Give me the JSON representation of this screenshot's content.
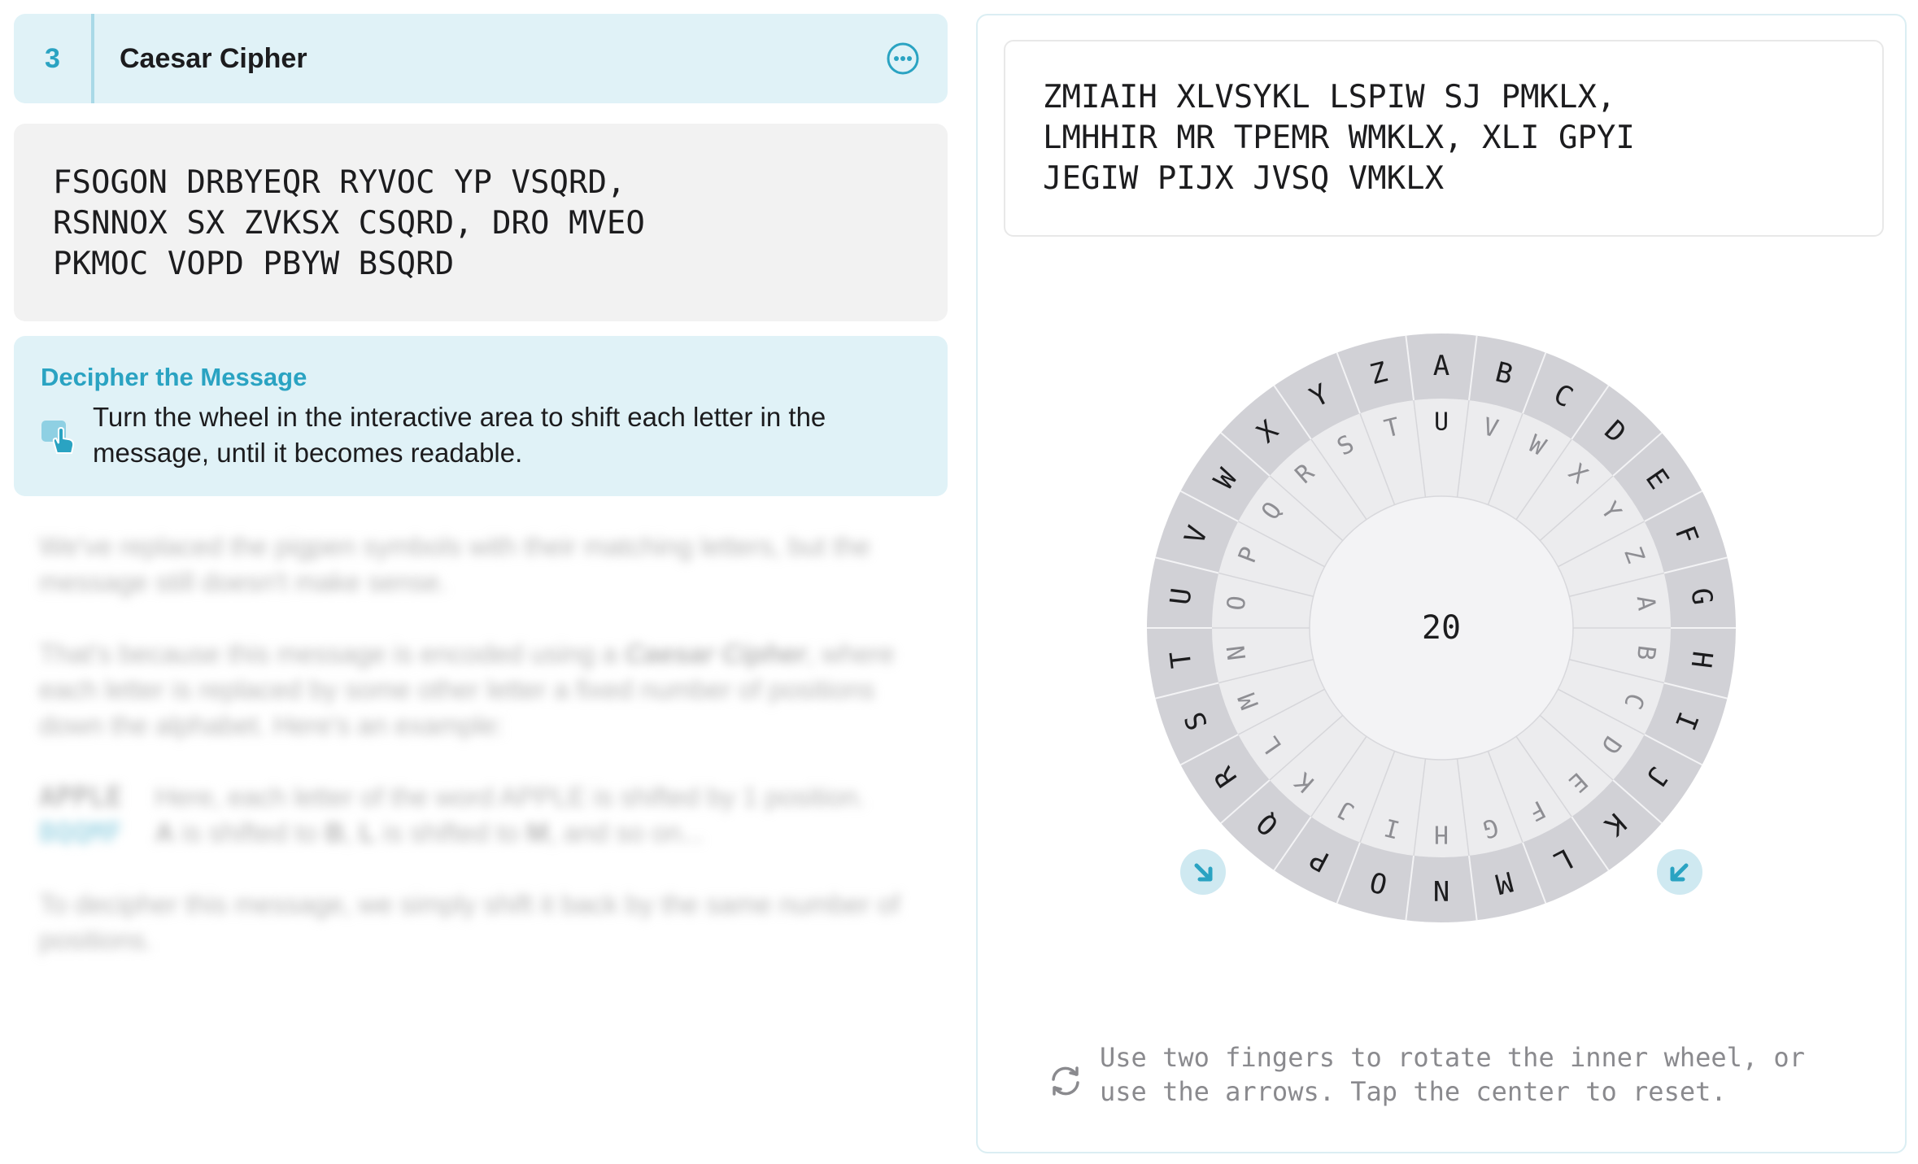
{
  "header": {
    "step_number": "3",
    "title": "Caesar Cipher",
    "more_icon": "ellipsis-circle-icon"
  },
  "cipher": {
    "lines": [
      "FSOGON DRBYEQR RYVOC YP VSQRD,",
      "RSNNOX SX ZVKSX CSQRD, DRO MVEO",
      "PKMOC VOPD PBYW BSQRD"
    ]
  },
  "instructions": {
    "title": "Decipher the Message",
    "text": "Turn the wheel in the interactive area to shift each letter in the message, until it becomes readable.",
    "icon": "hand-tap-icon"
  },
  "body": {
    "p1": "We've replaced the pigpen symbols with their matching letters, but the message still doesn't make sense.",
    "p2_start": "That's because this message is encoded using a ",
    "p2_em": "Caesar Cipher",
    "p2_end": ", where each letter is replaced by some other letter a fixed number of positions down the alphabet. Here's an example:",
    "example_plain": "APPLE",
    "example_cipher": "BQQMF",
    "example_line1": "Here, each letter of the word APPLE is shifted by 1 position.",
    "example_line2_a": "A",
    "example_line2_b": " is shifted to ",
    "example_line2_c": "B",
    "example_line2_d": ", ",
    "example_line2_e": "L",
    "example_line2_f": " is shifted to ",
    "example_line2_g": "M",
    "example_line2_h": ", and so on...",
    "p3": "To decipher this message, we simply shift it back by the same number of positions."
  },
  "output": {
    "lines": [
      "ZMIAIH XLVSYKL LSPIW SJ PMKLX,",
      "LMHHIR MR TPEMR WMKLX, XLI GPYI",
      "JEGIW PIJX JVSQ VMKLX"
    ]
  },
  "wheel": {
    "shift": "20",
    "outer_letters": [
      "A",
      "B",
      "C",
      "D",
      "E",
      "F",
      "G",
      "H",
      "I",
      "J",
      "K",
      "L",
      "M",
      "N",
      "O",
      "P",
      "Q",
      "R",
      "S",
      "T",
      "U",
      "V",
      "W",
      "X",
      "Y",
      "Z"
    ],
    "inner_letters": [
      "U",
      "V",
      "W",
      "X",
      "Y",
      "Z",
      "A",
      "B",
      "C",
      "D",
      "E",
      "F",
      "G",
      "H",
      "I",
      "J",
      "K",
      "L",
      "M",
      "N",
      "O",
      "P",
      "Q",
      "R",
      "S",
      "T"
    ],
    "inner_highlight": "U",
    "left_arrow_icon": "arrow-down-right-icon",
    "right_arrow_icon": "arrow-down-left-icon",
    "colors": {
      "outer_ring": "#d1d1d6",
      "inner_ring": "#ececee",
      "center": "#f3f3f5",
      "accent": "#2aa3c2",
      "arrow_bg": "#cfe9f1"
    }
  },
  "help": {
    "icon": "rotate-arrows-icon",
    "lines": [
      "Use two fingers to rotate the inner wheel, or",
      "use the arrows. Tap the center to reset."
    ]
  }
}
